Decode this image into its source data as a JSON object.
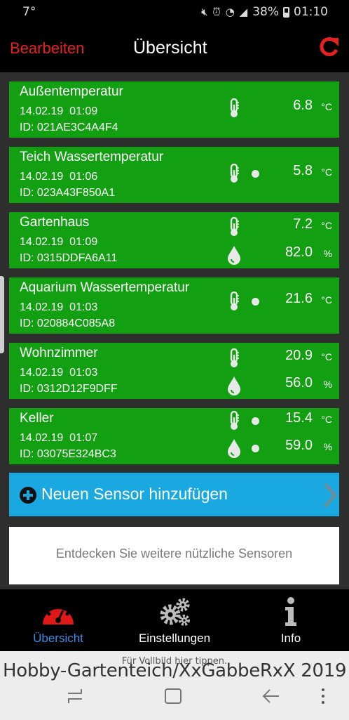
{
  "status_bar": {
    "temperature": "7°",
    "battery": "38%",
    "time": "01:10",
    "icons": [
      "mute-icon",
      "alarm-icon",
      "wifi-icon",
      "signal-icon",
      "battery-icon"
    ]
  },
  "header": {
    "edit_label": "Bearbeiten",
    "title": "Übersicht",
    "refresh_icon": "refresh-icon"
  },
  "colors": {
    "card_green": "#12a012",
    "accent_red": "#e82020",
    "add_blue": "#19a9e0",
    "active_tab_blue": "#3b8be8"
  },
  "sensors": [
    {
      "name": "Außentemperatur",
      "date": "14.02.19  01:09",
      "id": "ID: 021AE3C4A4F4",
      "readings": [
        {
          "icon": "thermometer-icon",
          "value": "6.8",
          "unit": "°C",
          "dot": false
        }
      ]
    },
    {
      "name": "Teich Wassertemperatur",
      "date": "14.02.19  01:06",
      "id": "ID: 023A43F850A1",
      "readings": [
        {
          "icon": "thermometer-icon",
          "value": "5.8",
          "unit": "°C",
          "dot": true
        }
      ]
    },
    {
      "name": "Gartenhaus",
      "date": "14.02.19  01:09",
      "id": "ID: 0315DDFA6A11",
      "readings": [
        {
          "icon": "thermometer-icon",
          "value": "7.2",
          "unit": "°C",
          "dot": false
        },
        {
          "icon": "humidity-drop-icon",
          "value": "82.0",
          "unit": "%",
          "dot": false
        }
      ]
    },
    {
      "name": "Aquarium Wassertemperatur",
      "date": "14.02.19  01:03",
      "id": "ID: 020884C085A8",
      "readings": [
        {
          "icon": "thermometer-icon",
          "value": "21.6",
          "unit": "°C",
          "dot": true
        }
      ]
    },
    {
      "name": "Wohnzimmer",
      "date": "14.02.19  01:03",
      "id": "ID: 0312D12F9DFF",
      "readings": [
        {
          "icon": "thermometer-icon",
          "value": "20.9",
          "unit": "°C",
          "dot": false
        },
        {
          "icon": "humidity-drop-icon",
          "value": "56.0",
          "unit": "%",
          "dot": false
        }
      ]
    },
    {
      "name": "Keller",
      "date": "14.02.19  01:07",
      "id": "ID: 03075E324BC3",
      "readings": [
        {
          "icon": "thermometer-icon",
          "value": "15.4",
          "unit": "°C",
          "dot": true
        },
        {
          "icon": "humidity-drop-icon",
          "value": "59.0",
          "unit": "%",
          "dot": true
        }
      ]
    }
  ],
  "add_sensor": {
    "label": "Neuen Sensor hinzufügen",
    "icon": "plus-circle-icon",
    "chevron": "chevron-right-icon"
  },
  "discover": {
    "label": "Entdecken Sie weitere nützliche Sensoren"
  },
  "tabs": [
    {
      "label": "Übersicht",
      "icon": "gauge-icon",
      "active": true
    },
    {
      "label": "Einstellungen",
      "icon": "gears-icon",
      "active": false
    },
    {
      "label": "Info",
      "icon": "info-icon",
      "active": false
    }
  ],
  "fullscreen_hint": "Für Vollbild hier tippen.",
  "watermark": "Hobby-Gartenteich/XxGabbeRxX 2019",
  "nav": [
    "recents-icon",
    "home-icon",
    "back-icon",
    "more-icon"
  ]
}
